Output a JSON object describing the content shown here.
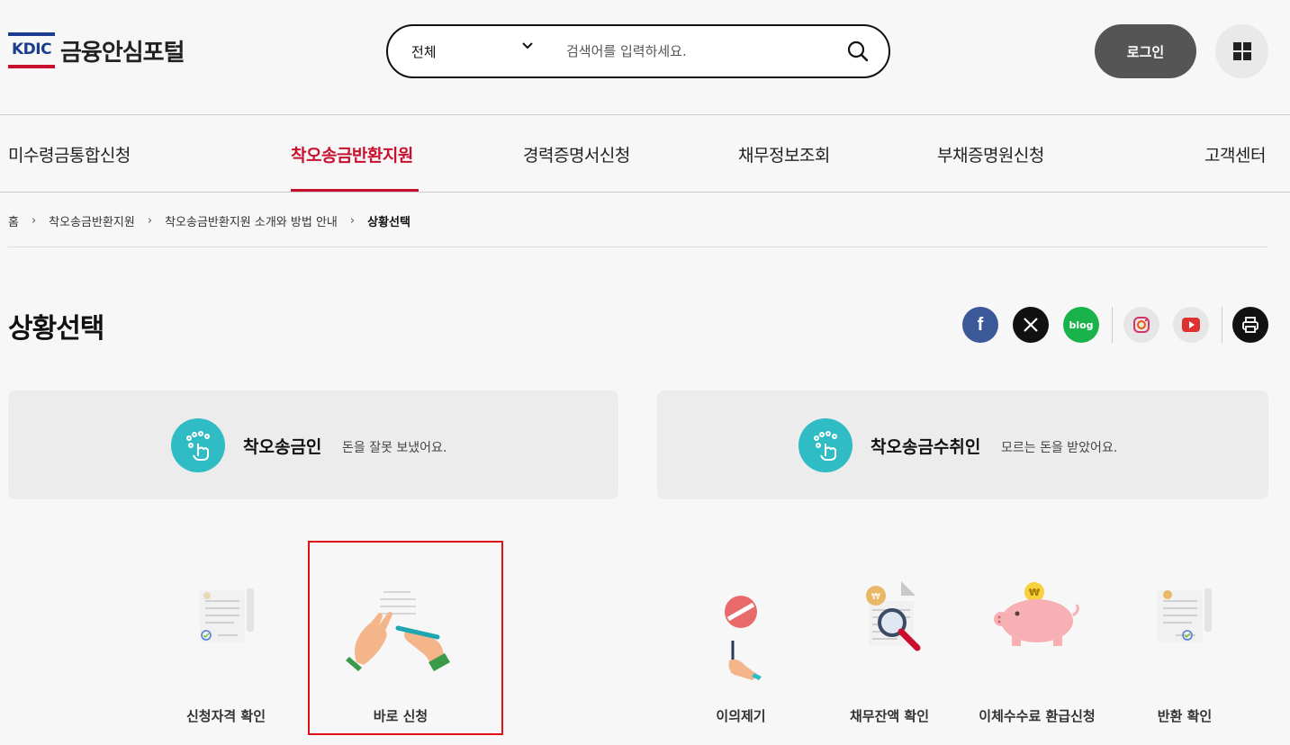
{
  "header": {
    "logo_mark": "KDIC",
    "logo_title": "금융안심포털",
    "search": {
      "scope": "전체",
      "placeholder": "검색어를 입력하세요."
    },
    "login_label": "로그인"
  },
  "nav": {
    "items": [
      {
        "label": "미수령금통합신청"
      },
      {
        "label": "착오송금반환지원"
      },
      {
        "label": "경력증명서신청"
      },
      {
        "label": "채무정보조회"
      },
      {
        "label": "부채증명원신청"
      },
      {
        "label": "고객센터"
      }
    ],
    "active_index": 1
  },
  "breadcrumb": {
    "items": [
      "홈",
      "착오송금반환지원",
      "착오송금반환지원 소개와 방법 안내",
      "상황선택"
    ]
  },
  "page": {
    "title": "상황선택"
  },
  "social": {
    "facebook": "f",
    "blog": "blog",
    "icons": [
      "facebook-icon",
      "x-icon",
      "blog-icon",
      "instagram-icon",
      "youtube-icon",
      "print-icon"
    ]
  },
  "tabs": [
    {
      "name": "착오송금인",
      "desc": "돈을 잘못 보냈어요."
    },
    {
      "name": "착오송금수취인",
      "desc": "모르는 돈을 받았어요."
    }
  ],
  "items_left": [
    {
      "label": "신청자격 확인"
    },
    {
      "label": "바로 신청"
    }
  ],
  "items_right": [
    {
      "label": "이의제기"
    },
    {
      "label": "채무잔액 확인"
    },
    {
      "label": "이체수수료 환급신청"
    },
    {
      "label": "반환 확인"
    }
  ],
  "colors": {
    "accent": "#c8102e",
    "teal": "#2fbcc4",
    "highlight": "#e10f16"
  }
}
